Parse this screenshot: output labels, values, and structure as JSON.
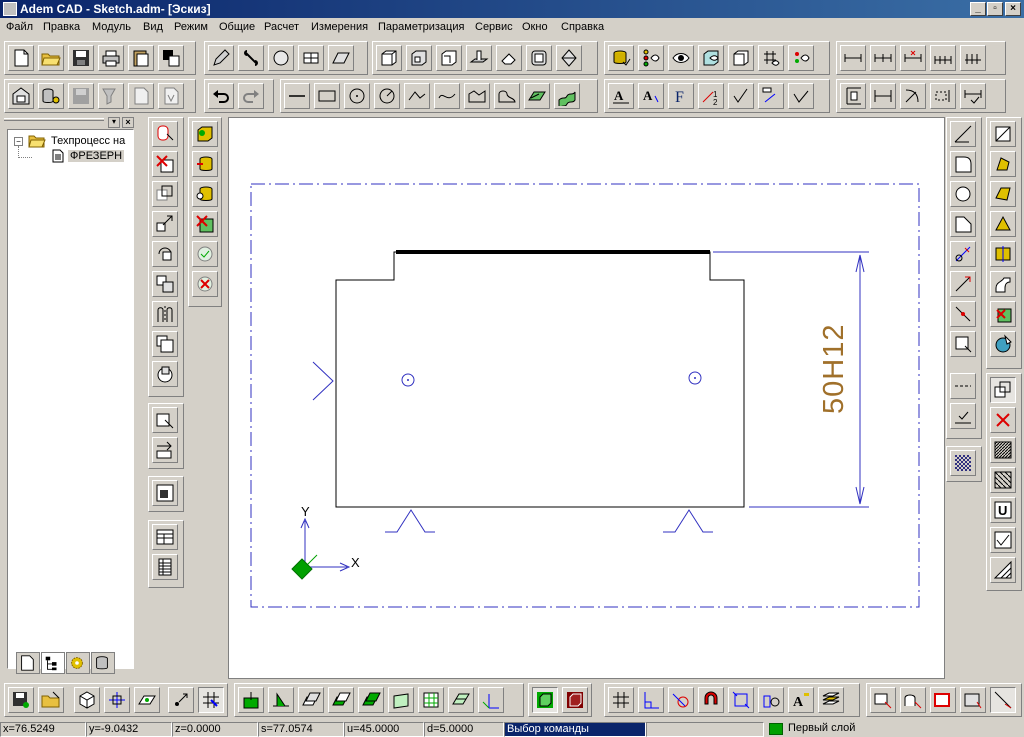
{
  "window": {
    "title": "Adem CAD - Sketch.adm- [Эскиз]",
    "controls": [
      "_",
      "▫",
      "×"
    ]
  },
  "menu": [
    "Файл",
    "Правка",
    "Модуль",
    "Вид",
    "Режим",
    "Общие",
    "Расчет",
    "Измерения",
    "Параметризация",
    "Сервис",
    "Окно",
    "Справка"
  ],
  "tree": {
    "root": "Техпроцесс на",
    "child": "ФРЕЗЕРН"
  },
  "drawing": {
    "dimension": "50H12",
    "axis_x": "X",
    "axis_y": "Y"
  },
  "colors": {
    "title_start": "#0a246a",
    "title_end": "#3a6ea5",
    "drawing_blue": "#3030c0",
    "dimension_text": "#a0702a",
    "layer_green": "#00a000",
    "status_highlight": "#0a246a"
  },
  "status": {
    "x": "x=76.5249",
    "y": "y=-9.0432",
    "z": "z=0.0000",
    "s": "s=77.0574",
    "u": "u=45.0000",
    "d": "d=5.0000",
    "command": "Выбор команды",
    "layer": "Первый слой"
  }
}
